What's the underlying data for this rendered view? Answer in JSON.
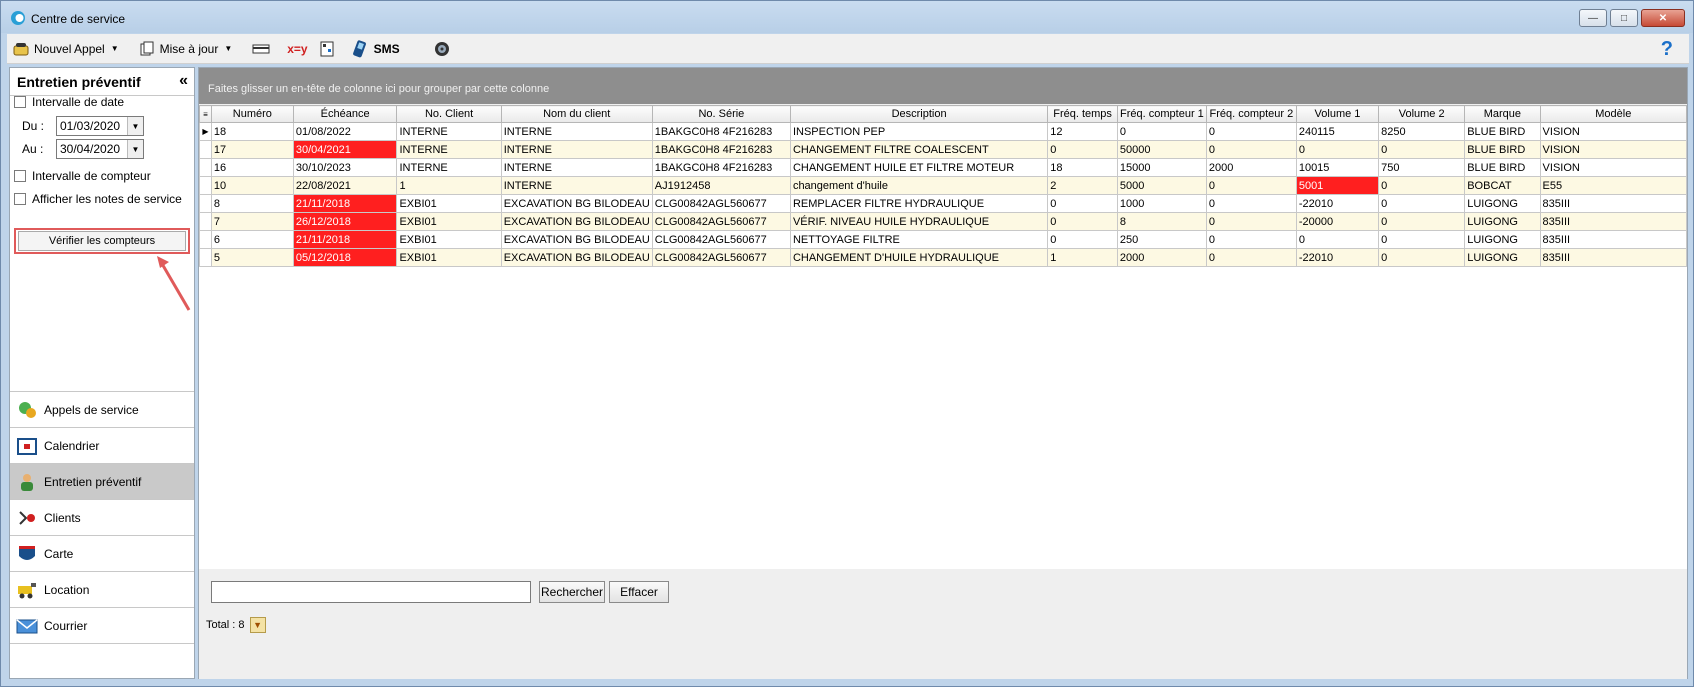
{
  "window": {
    "title": "Centre de service"
  },
  "toolbar": {
    "new_call": "Nouvel Appel",
    "update": "Mise à jour",
    "sms": "SMS"
  },
  "left": {
    "header": "Entretien préventif",
    "date_interval": "Intervalle de date",
    "du_label": "Du :",
    "du_value": "01/03/2020",
    "au_label": "Au :",
    "au_value": "30/04/2020",
    "counter_interval": "Intervalle de compteur",
    "show_notes": "Afficher les notes de service",
    "verify_button": "Vérifier les compteurs",
    "nav": [
      {
        "label": "Appels de service",
        "icon": "service-calls-icon"
      },
      {
        "label": "Calendrier",
        "icon": "calendar-icon"
      },
      {
        "label": "Entretien préventif",
        "icon": "maintenance-icon"
      },
      {
        "label": "Clients",
        "icon": "clients-icon"
      },
      {
        "label": "Carte",
        "icon": "map-icon"
      },
      {
        "label": "Location",
        "icon": "rental-icon"
      },
      {
        "label": "Courrier",
        "icon": "mail-icon"
      }
    ]
  },
  "grid": {
    "group_hint": "Faites glisser un en-tête de colonne ici pour grouper par cette colonne",
    "columns": [
      "Numéro",
      "Échéance",
      "No. Client",
      "Nom du client",
      "No. Série",
      "Description",
      "Fréq. temps",
      "Fréq. compteur 1",
      "Fréq. compteur 2",
      "Volume 1",
      "Volume 2",
      "Marque",
      "Modèle"
    ],
    "rows": [
      [
        "18",
        "01/08/2022",
        "INTERNE",
        "INTERNE",
        "1BAKGC0H8 4F216283",
        "INSPECTION PEP",
        "12",
        "0",
        "0",
        "240115",
        "8250",
        "BLUE BIRD",
        "VISION"
      ],
      [
        "17",
        "30/04/2021",
        "INTERNE",
        "INTERNE",
        "1BAKGC0H8 4F216283",
        "CHANGEMENT FILTRE COALESCENT",
        "0",
        "50000",
        "0",
        "0",
        "0",
        "BLUE BIRD",
        "VISION"
      ],
      [
        "16",
        "30/10/2023",
        "INTERNE",
        "INTERNE",
        "1BAKGC0H8 4F216283",
        "CHANGEMENT HUILE ET FILTRE MOTEUR",
        "18",
        "15000",
        "2000",
        "10015",
        "750",
        "BLUE BIRD",
        "VISION"
      ],
      [
        "10",
        "22/08/2021",
        "1",
        "INTERNE",
        "AJ1912458",
        "changement d'huile",
        "2",
        "5000",
        "0",
        "5001",
        "0",
        "BOBCAT",
        "E55"
      ],
      [
        "8",
        "21/11/2018",
        "EXBI01",
        "EXCAVATION BG BILODEAU",
        "CLG00842AGL560677",
        "REMPLACER FILTRE HYDRAULIQUE",
        "0",
        "1000",
        "0",
        "-22010",
        "0",
        "LUIGONG",
        "835III"
      ],
      [
        "7",
        "26/12/2018",
        "EXBI01",
        "EXCAVATION BG BILODEAU",
        "CLG00842AGL560677",
        "VÉRIF. NIVEAU HUILE HYDRAULIQUE",
        "0",
        "8",
        "0",
        "-20000",
        "0",
        "LUIGONG",
        "835III"
      ],
      [
        "6",
        "21/11/2018",
        "EXBI01",
        "EXCAVATION BG BILODEAU",
        "CLG00842AGL560677",
        "NETTOYAGE FILTRE",
        "0",
        "250",
        "0",
        "0",
        "0",
        "LUIGONG",
        "835III"
      ],
      [
        "5",
        "05/12/2018",
        "EXBI01",
        "EXCAVATION BG BILODEAU",
        "CLG00842AGL560677",
        "CHANGEMENT D'HUILE HYDRAULIQUE",
        "1",
        "2000",
        "0",
        "-22010",
        "0",
        "LUIGONG",
        "835III"
      ]
    ],
    "red_cells": [
      [
        1,
        1
      ],
      [
        3,
        9
      ],
      [
        4,
        1
      ],
      [
        5,
        1
      ],
      [
        6,
        1
      ],
      [
        7,
        1
      ]
    ]
  },
  "bottom": {
    "search_value": "",
    "search_button": "Rechercher",
    "clear_button": "Effacer",
    "total": "Total : 8"
  },
  "colors": {
    "overdue": "#ff1f1f",
    "alt_row": "#fdf9e3",
    "annotation": "#e05a5a"
  }
}
